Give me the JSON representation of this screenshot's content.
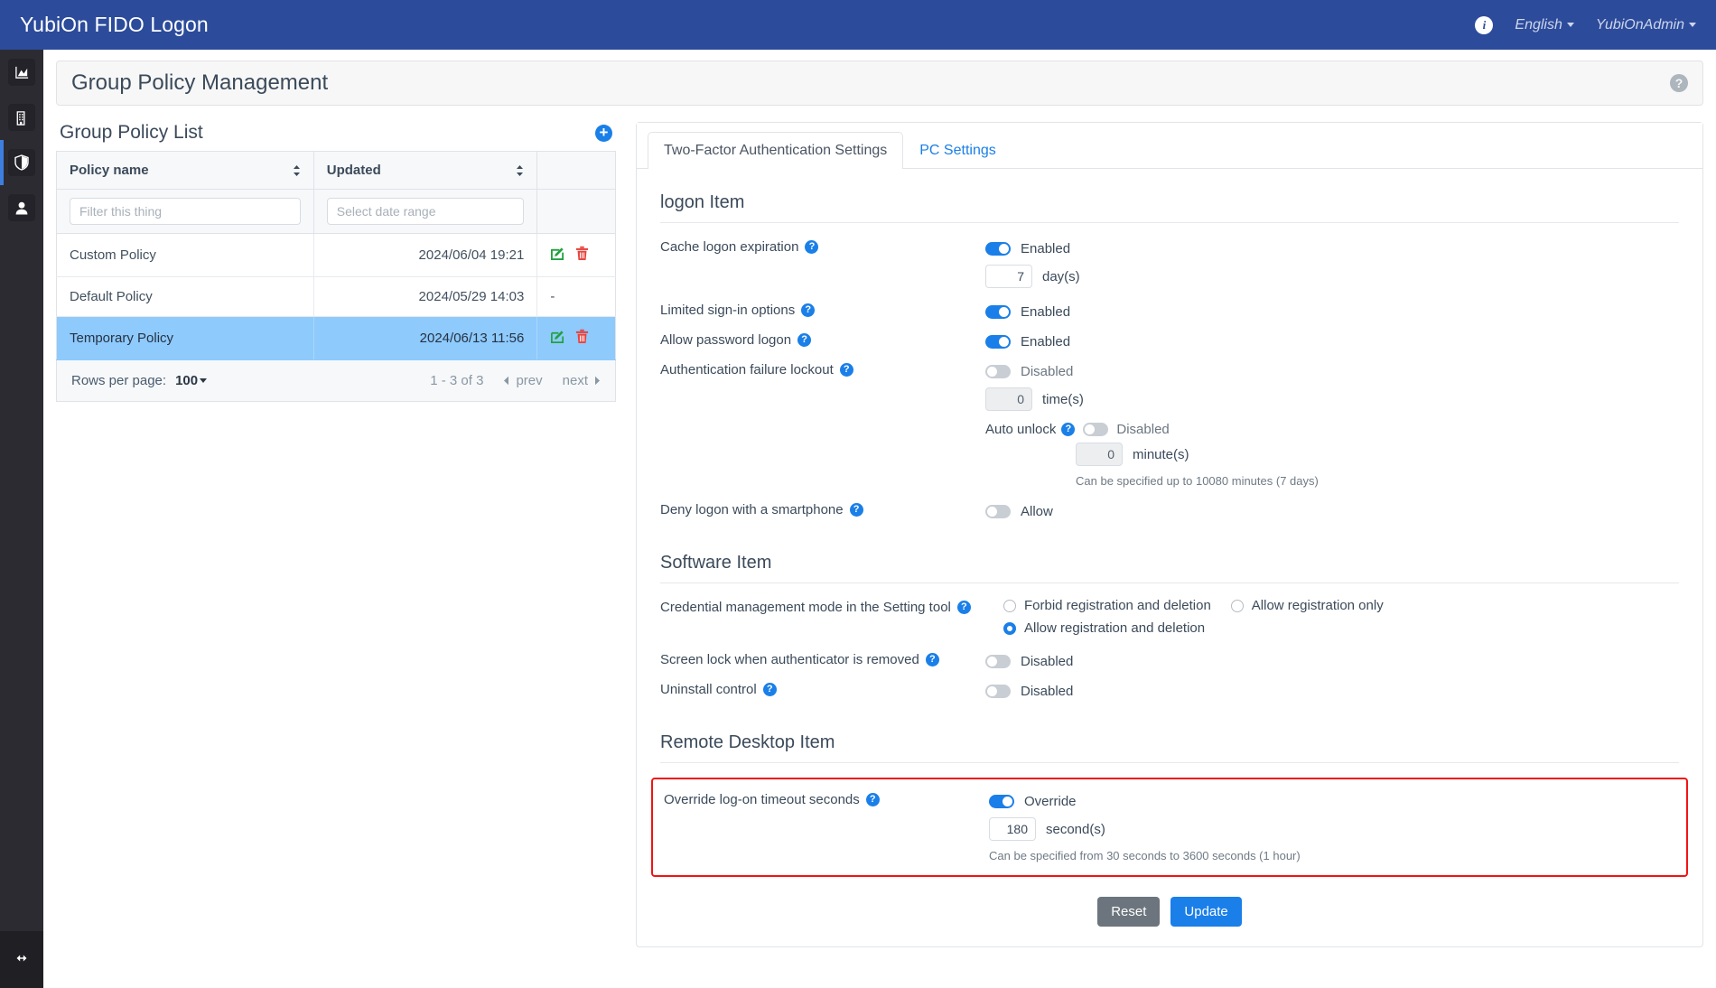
{
  "navbar": {
    "brand": "YubiOn FIDO Logon",
    "info_icon": "info-icon",
    "language": "English",
    "account": "YubiOnAdmin"
  },
  "sidebar": {
    "items": [
      {
        "icon": "chart-area-icon",
        "name": "dashboard"
      },
      {
        "icon": "building-icon",
        "name": "organization"
      },
      {
        "icon": "shield-icon",
        "name": "policy",
        "active": true
      },
      {
        "icon": "user-icon",
        "name": "users"
      }
    ],
    "collapse_icon": "arrows-left-right-icon"
  },
  "page": {
    "title": "Group Policy Management",
    "help_icon": "question-circle-icon"
  },
  "policy_list": {
    "title": "Group Policy List",
    "add_icon": "plus-circle-icon",
    "columns": [
      {
        "label": "Policy name",
        "sortable": true
      },
      {
        "label": "Updated",
        "sortable": true
      }
    ],
    "filters": {
      "name_placeholder": "Filter this thing",
      "name_value": "",
      "date_placeholder": "Select date range",
      "date_value": ""
    },
    "rows": [
      {
        "name": "Custom Policy",
        "updated": "2024/06/04 19:21",
        "actions": "edit-delete",
        "selected": false
      },
      {
        "name": "Default Policy",
        "updated": "2024/05/29 14:03",
        "actions": "none",
        "dash": "-",
        "selected": false
      },
      {
        "name": "Temporary Policy",
        "updated": "2024/06/13 11:56",
        "actions": "edit-delete",
        "selected": true
      }
    ],
    "pager": {
      "rows_per_page_label": "Rows per page:",
      "rows_per_page_value": "100",
      "range": "1 - 3 of 3",
      "prev": "prev",
      "next": "next"
    }
  },
  "settings": {
    "tabs": [
      {
        "label": "Two-Factor Authentication Settings",
        "active": true
      },
      {
        "label": "PC Settings",
        "active": false
      }
    ],
    "sections": {
      "logon": {
        "title": "logon Item",
        "cache_logon_expiration": {
          "label": "Cache logon expiration",
          "toggle_state": "Enabled",
          "value": "7",
          "unit": "day(s)"
        },
        "limited_signin": {
          "label": "Limited sign-in options",
          "toggle_state": "Enabled"
        },
        "allow_password_logon": {
          "label": "Allow password logon",
          "toggle_state": "Enabled"
        },
        "auth_failure_lockout": {
          "label": "Authentication failure lockout",
          "toggle_state": "Disabled",
          "value": "0",
          "unit": "time(s)",
          "auto_unlock_label": "Auto unlock",
          "auto_unlock_state": "Disabled",
          "auto_unlock_value": "0",
          "auto_unlock_unit": "minute(s)",
          "hint": "Can be specified up to 10080 minutes (7 days)"
        },
        "deny_smartphone": {
          "label": "Deny logon with a smartphone",
          "toggle_state": "Allow"
        }
      },
      "software": {
        "title": "Software Item",
        "credential_mode": {
          "label": "Credential management mode in the Setting tool",
          "options": [
            {
              "label": "Forbid registration and deletion",
              "checked": false
            },
            {
              "label": "Allow registration only",
              "checked": false
            },
            {
              "label": "Allow registration and deletion",
              "checked": true
            }
          ]
        },
        "screen_lock": {
          "label": "Screen lock when authenticator is removed",
          "toggle_state": "Disabled"
        },
        "uninstall_control": {
          "label": "Uninstall control",
          "toggle_state": "Disabled"
        }
      },
      "remote_desktop": {
        "title": "Remote Desktop Item",
        "override_timeout": {
          "label": "Override log-on timeout seconds",
          "toggle_state": "Override",
          "value": "180",
          "unit": "second(s)",
          "hint": "Can be specified from 30 seconds to 3600 seconds (1 hour)",
          "highlighted": true
        }
      }
    },
    "buttons": {
      "reset": "Reset",
      "update": "Update"
    }
  },
  "colors": {
    "navbar": "#2c4b9b",
    "accent": "#1a7fe8",
    "sidebar": "#2b2b31",
    "selected_row": "#8ecafc",
    "highlight_border": "#f01414",
    "reset_button": "#6c757d"
  }
}
